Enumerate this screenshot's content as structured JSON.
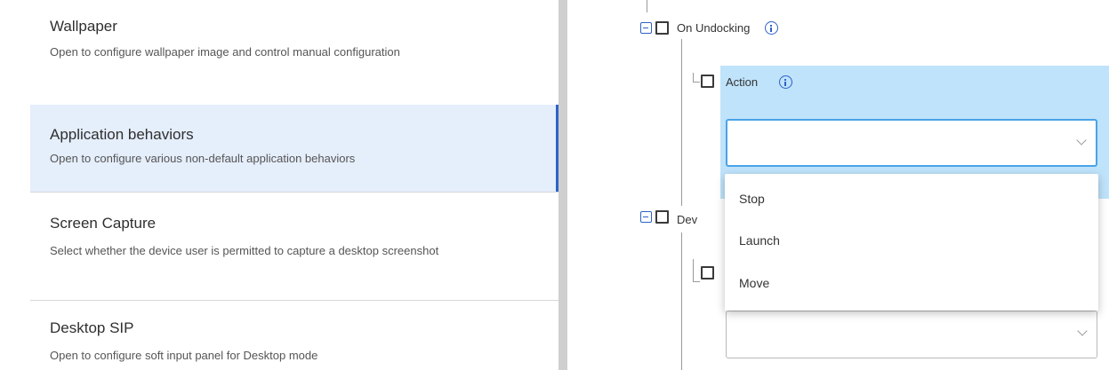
{
  "categories": [
    {
      "title": "Wallpaper",
      "description": "Open to configure wallpaper image and control manual configuration"
    },
    {
      "title": "Application behaviors",
      "description": "Open to configure various non-default application behaviors"
    },
    {
      "title": "Screen Capture",
      "description": "Select whether the device user is permitted to capture a desktop screenshot"
    },
    {
      "title": "Desktop SIP",
      "description": "Open to configure soft input panel for Desktop mode"
    }
  ],
  "selected_category": "Application behaviors",
  "tree": {
    "on_undocking_label": "On Undocking",
    "action_label": "Action",
    "action_value": "",
    "dev_label": "Dev",
    "other_select_value": ""
  },
  "dropdown": {
    "options": [
      "Stop",
      "Launch",
      "Move"
    ]
  },
  "colors": {
    "accent": "#2d62c8",
    "selected_bg": "#e5eefb",
    "action_highlight": "#bfe3fb"
  }
}
